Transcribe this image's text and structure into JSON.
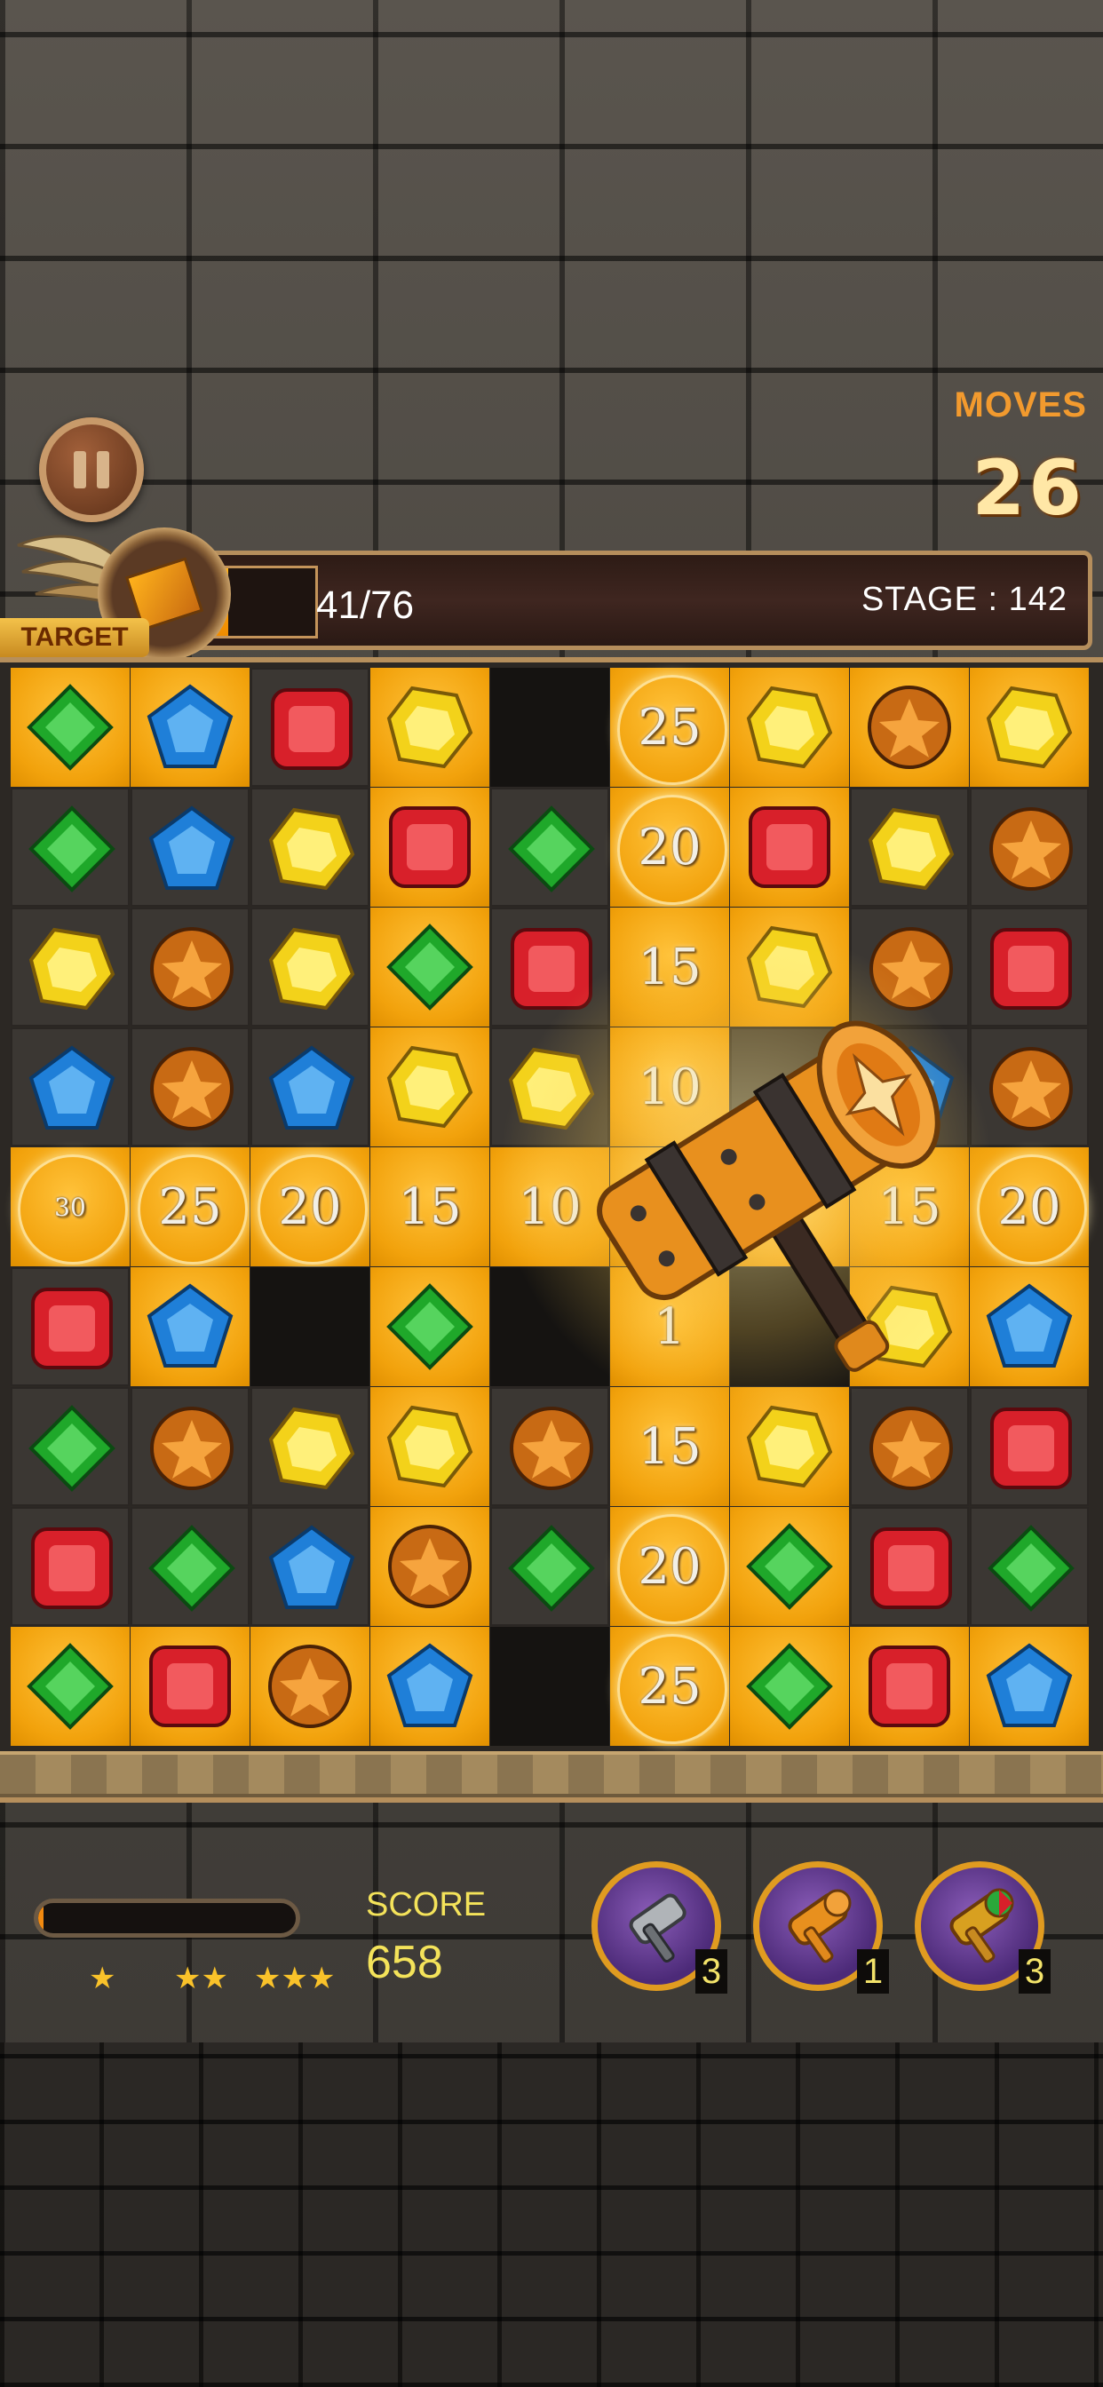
{
  "hud": {
    "moves_label": "MOVES",
    "moves_value": "26",
    "target_label": "TARGET",
    "target_progress_text": "41/76",
    "target_progress_fraction": 0.54,
    "stage_text": "STAGE : 142"
  },
  "board": {
    "rows": [
      [
        {
          "bg": "gold",
          "gem": "green"
        },
        {
          "bg": "gold",
          "gem": "blue"
        },
        {
          "bg": "dark",
          "gem": "red"
        },
        {
          "bg": "gold",
          "gem": "yellow"
        },
        {
          "bg": "empty",
          "gem": ""
        },
        {
          "bg": "gold",
          "gem": "",
          "label": "25",
          "ring": true
        },
        {
          "bg": "gold",
          "gem": "yellow"
        },
        {
          "bg": "gold",
          "gem": "orange"
        },
        {
          "bg": "gold",
          "gem": "yellow"
        }
      ],
      [
        {
          "bg": "dark",
          "gem": "green"
        },
        {
          "bg": "dark",
          "gem": "blue"
        },
        {
          "bg": "dark",
          "gem": "yellow"
        },
        {
          "bg": "gold",
          "gem": "red"
        },
        {
          "bg": "dark",
          "gem": "green"
        },
        {
          "bg": "gold",
          "gem": "",
          "label": "20",
          "ring": true
        },
        {
          "bg": "gold",
          "gem": "red"
        },
        {
          "bg": "dark",
          "gem": "yellow"
        },
        {
          "bg": "dark",
          "gem": "orange"
        }
      ],
      [
        {
          "bg": "dark",
          "gem": "yellow"
        },
        {
          "bg": "dark",
          "gem": "orange"
        },
        {
          "bg": "dark",
          "gem": "yellow"
        },
        {
          "bg": "gold",
          "gem": "green"
        },
        {
          "bg": "dark",
          "gem": "red"
        },
        {
          "bg": "gold",
          "gem": "",
          "label": "15",
          "ring": false
        },
        {
          "bg": "gold",
          "gem": "yellow"
        },
        {
          "bg": "dark",
          "gem": "orange"
        },
        {
          "bg": "dark",
          "gem": "red"
        }
      ],
      [
        {
          "bg": "dark",
          "gem": "blue"
        },
        {
          "bg": "dark",
          "gem": "orange"
        },
        {
          "bg": "dark",
          "gem": "blue"
        },
        {
          "bg": "gold",
          "gem": "yellow"
        },
        {
          "bg": "dark",
          "gem": "yellow"
        },
        {
          "bg": "gold",
          "gem": "",
          "label": "10",
          "ring": false
        },
        {
          "bg": "dark",
          "gem": ""
        },
        {
          "bg": "dark",
          "gem": "blue"
        },
        {
          "bg": "dark",
          "gem": "orange"
        }
      ],
      [
        {
          "bg": "gold",
          "gem": "",
          "label": "30",
          "ring": true,
          "small": true
        },
        {
          "bg": "gold",
          "gem": "",
          "label": "25",
          "ring": true
        },
        {
          "bg": "gold",
          "gem": "",
          "label": "20",
          "ring": true
        },
        {
          "bg": "gold",
          "gem": "",
          "label": "15",
          "ring": false
        },
        {
          "bg": "gold",
          "gem": "",
          "label": "10",
          "ring": false
        },
        {
          "bg": "gold",
          "gem": ""
        },
        {
          "bg": "gold",
          "gem": ""
        },
        {
          "bg": "gold",
          "gem": "",
          "label": "15",
          "ring": false
        },
        {
          "bg": "gold",
          "gem": "",
          "label": "20",
          "ring": true
        }
      ],
      [
        {
          "bg": "dark",
          "gem": "red"
        },
        {
          "bg": "gold",
          "gem": "blue"
        },
        {
          "bg": "empty",
          "gem": ""
        },
        {
          "bg": "gold",
          "gem": "green"
        },
        {
          "bg": "empty",
          "gem": ""
        },
        {
          "bg": "gold",
          "gem": "",
          "label": "1",
          "ring": false
        },
        {
          "bg": "empty",
          "gem": ""
        },
        {
          "bg": "gold",
          "gem": "yellow"
        },
        {
          "bg": "gold",
          "gem": "blue"
        }
      ],
      [
        {
          "bg": "dark",
          "gem": "green"
        },
        {
          "bg": "dark",
          "gem": "orange"
        },
        {
          "bg": "dark",
          "gem": "yellow"
        },
        {
          "bg": "gold",
          "gem": "yellow"
        },
        {
          "bg": "dark",
          "gem": "orange"
        },
        {
          "bg": "gold",
          "gem": "",
          "label": "15",
          "ring": false
        },
        {
          "bg": "gold",
          "gem": "yellow"
        },
        {
          "bg": "dark",
          "gem": "orange"
        },
        {
          "bg": "dark",
          "gem": "red"
        }
      ],
      [
        {
          "bg": "dark",
          "gem": "red"
        },
        {
          "bg": "dark",
          "gem": "green"
        },
        {
          "bg": "dark",
          "gem": "blue"
        },
        {
          "bg": "gold",
          "gem": "orange"
        },
        {
          "bg": "dark",
          "gem": "green"
        },
        {
          "bg": "gold",
          "gem": "",
          "label": "20",
          "ring": true
        },
        {
          "bg": "gold",
          "gem": "green"
        },
        {
          "bg": "dark",
          "gem": "red"
        },
        {
          "bg": "dark",
          "gem": "green"
        }
      ],
      [
        {
          "bg": "gold",
          "gem": "green"
        },
        {
          "bg": "gold",
          "gem": "red"
        },
        {
          "bg": "gold",
          "gem": "orange"
        },
        {
          "bg": "gold",
          "gem": "blue"
        },
        {
          "bg": "empty",
          "gem": ""
        },
        {
          "bg": "gold",
          "gem": "",
          "label": "25",
          "ring": true
        },
        {
          "bg": "gold",
          "gem": "green"
        },
        {
          "bg": "gold",
          "gem": "red"
        },
        {
          "bg": "gold",
          "gem": "blue"
        }
      ]
    ]
  },
  "bottom": {
    "score_label": "SCORE",
    "score_value": "658",
    "score_progress_fraction": 0.02,
    "boosters": [
      {
        "name": "pickaxe-booster",
        "icon": "pickaxe-icon",
        "count": "3"
      },
      {
        "name": "hammer-booster",
        "icon": "hammer-icon",
        "count": "1"
      },
      {
        "name": "rainbow-hammer-booster",
        "icon": "rainbow-hammer-icon",
        "count": "3"
      }
    ]
  },
  "colors": {
    "moves_label": "#f29a2e",
    "score_text": "#f4e35a",
    "gold_tile": "#f2a20c",
    "gem_green": "#1fa82a",
    "gem_blue": "#1f7fd8",
    "gem_red": "#d8202a",
    "gem_yellow": "#f3d21a",
    "gem_orange": "#c86a14"
  }
}
